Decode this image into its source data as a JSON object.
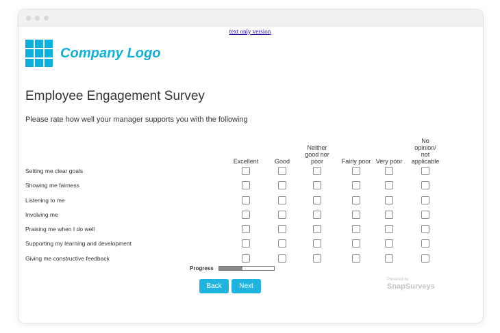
{
  "links": {
    "text_only": "text only version"
  },
  "logo": {
    "text": "Company Logo",
    "color": "#0cb0e0"
  },
  "survey": {
    "title": "Employee Engagement Survey",
    "question": "Please rate how well your manager supports you with the following",
    "columns": [
      [
        "Excellent"
      ],
      [
        "Good"
      ],
      [
        "Neither",
        "good nor",
        "poor"
      ],
      [
        "Fairly poor"
      ],
      [
        "Very poor"
      ],
      [
        "No",
        "opinion/",
        "not",
        "applicable"
      ]
    ],
    "rows": [
      "Setting me clear goals",
      "Showing me fairness",
      "Listening to me",
      "Involving me",
      "Praising me when I do well",
      "Supporting my learning and development",
      "Giving me constructive feedback"
    ]
  },
  "progress": {
    "label": "Progress",
    "fraction": 0.42
  },
  "buttons": {
    "back": "Back",
    "next": "Next",
    "color": "#1fb3e0"
  },
  "footer": {
    "powered_by": "Powered by",
    "brand": "SnapSurveys"
  }
}
